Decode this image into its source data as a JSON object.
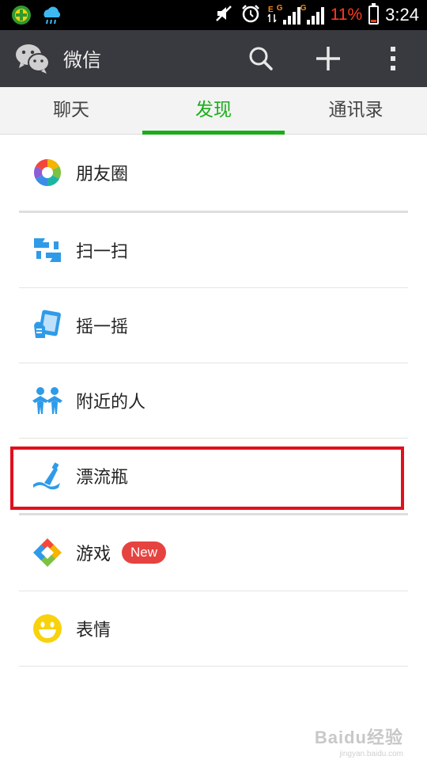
{
  "status_bar": {
    "time": "3:24",
    "battery_percent": "11%",
    "signal_1_label": "G",
    "signal_2_label": "G",
    "icons": [
      "app-icon",
      "weather-icon",
      "mute-icon",
      "alarm-icon",
      "data-icon",
      "signal-icon",
      "signal-icon",
      "battery-icon"
    ]
  },
  "action_bar": {
    "title": "微信",
    "icons": [
      "wechat-logo-icon",
      "search-icon",
      "plus-icon",
      "more-icon"
    ]
  },
  "tabs": [
    {
      "label": "聊天",
      "active": false
    },
    {
      "label": "发现",
      "active": true
    },
    {
      "label": "通讯录",
      "active": false
    }
  ],
  "discover_items": [
    {
      "label": "朋友圈",
      "icon": "moments-icon"
    },
    {
      "label": "扫一扫",
      "icon": "scan-icon"
    },
    {
      "label": "摇一摇",
      "icon": "shake-icon"
    },
    {
      "label": "附近的人",
      "icon": "people-nearby-icon"
    },
    {
      "label": "漂流瓶",
      "icon": "drift-bottle-icon"
    },
    {
      "label": "游戏",
      "icon": "games-icon",
      "badge": "New"
    },
    {
      "label": "表情",
      "icon": "stickers-icon"
    }
  ],
  "watermark": {
    "text": "Baidu经验",
    "sub": "jingyan.baidu.com"
  },
  "colors": {
    "accent_green": "#1aad19",
    "action_bar": "#393a3f",
    "highlight_red": "#e0101d",
    "badge_red": "#e64340"
  }
}
